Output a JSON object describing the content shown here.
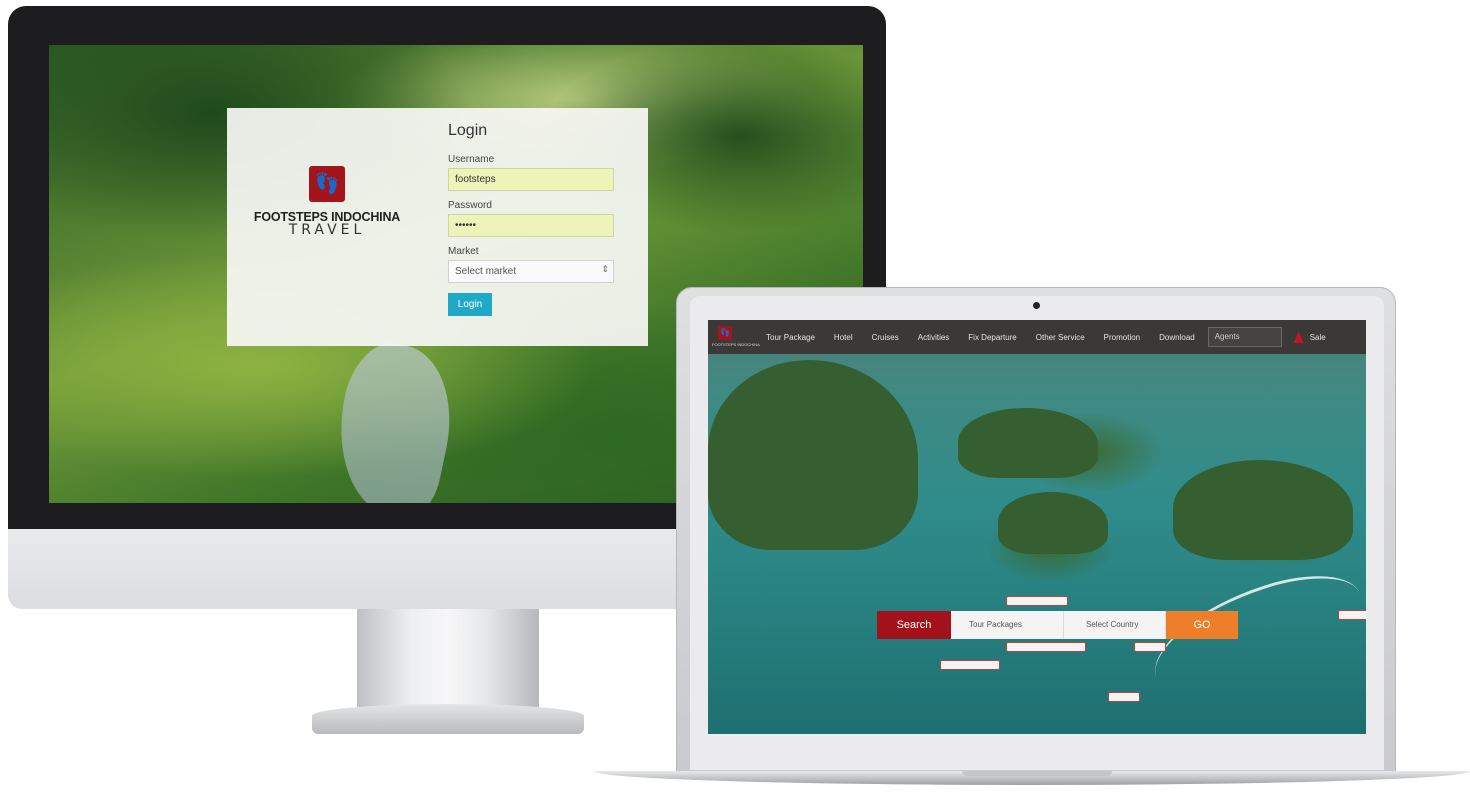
{
  "brand": {
    "logo_glyph": "👣",
    "name": "FOOTSTEPS INDOCHINA",
    "sub": "TRAVEL",
    "accent_color": "#a3141d"
  },
  "login": {
    "title": "Login",
    "username_label": "Username",
    "username_value": "footsteps",
    "password_label": "Password",
    "password_value": "••••••",
    "market_label": "Market",
    "market_selected": "Select market",
    "login_button": "Login"
  },
  "site": {
    "logo_text": "FOOTSTEPS INDOCHINA",
    "nav": [
      "Tour Package",
      "Hotel",
      "Cruises",
      "Activities",
      "Fix Departure",
      "Other Service",
      "Promotion",
      "Download"
    ],
    "agents_placeholder": "Agents",
    "sales_label": "Sale"
  },
  "search": {
    "label": "Search",
    "type_value": "Tour Packages",
    "country_value": "Select Country",
    "go_button": "GO",
    "colors": {
      "search": "#a3121a",
      "go": "#ef7e2b"
    }
  }
}
